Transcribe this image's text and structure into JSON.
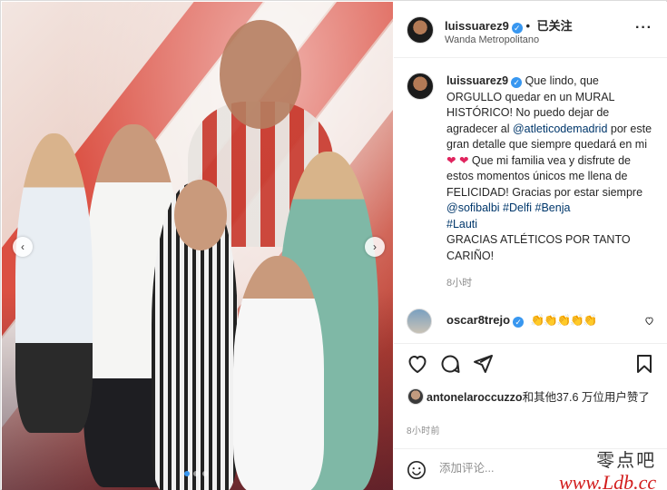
{
  "post": {
    "username": "luissuarez9",
    "follow_status": "已关注",
    "location": "Wanda Metropolitano",
    "more_icon": "···"
  },
  "caption": {
    "username": "luissuarez9",
    "text_1": "Que lindo, que ORGULLO quedar en un MURAL HISTÓRICO! No puedo dejar de agradecer al",
    "mention_1": "@atleticodemadrid",
    "text_2": "por este gran detalle que siempre quedará en mi",
    "hearts": "❤ ❤",
    "text_3": "Que mi familia vea y disfrute de estos momentos únicos me llena de FELICIDAD! Gracias por estar siempre",
    "mention_2": "@sofibalbi",
    "tag_1": "#Delfi",
    "tag_2": "#Benja",
    "tag_3": "#Lauti",
    "text_4": "GRACIAS ATLÉTICOS POR TANTO CARIÑO!",
    "time": "8小时"
  },
  "comment": {
    "username": "oscar8trejo",
    "text": "👏👏👏👏👏"
  },
  "likes": {
    "username": "antonelaroccuzzo",
    "text": "和其他37.6 万位用户赞了"
  },
  "post_time": "8小时前",
  "comment_input": {
    "placeholder": "添加评论..."
  },
  "watermark": {
    "title": "零点吧",
    "site": "www.Ldb.cc"
  },
  "colors": {
    "verified": "#3897f0",
    "mention": "#00376b",
    "heart": "#e0245e"
  },
  "icons": {
    "like": "heart-icon",
    "comment": "comment-icon",
    "share": "paper-plane-icon",
    "save": "bookmark-icon",
    "emoji": "smiley-icon"
  }
}
